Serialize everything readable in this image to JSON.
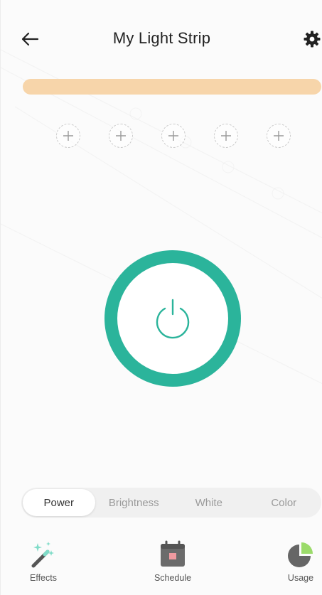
{
  "header": {
    "title": "My Light Strip",
    "back_icon": "arrow-left-icon",
    "settings_icon": "gear-icon"
  },
  "color_bar": {
    "color": "#f7d5aa"
  },
  "presets": [
    {
      "icon": "plus-icon"
    },
    {
      "icon": "plus-icon"
    },
    {
      "icon": "plus-icon"
    },
    {
      "icon": "plus-icon"
    },
    {
      "icon": "plus-icon"
    }
  ],
  "power_button": {
    "icon": "power-icon",
    "ring_color": "#2bb49b"
  },
  "mode_tabs": [
    {
      "label": "Power",
      "active": true
    },
    {
      "label": "Brightness",
      "active": false
    },
    {
      "label": "White",
      "active": false
    },
    {
      "label": "Color",
      "active": false
    }
  ],
  "toolbar": {
    "effects_label": "Effects",
    "schedule_label": "Schedule",
    "usage_label": "Usage",
    "effects_icon": "magic-wand-icon",
    "schedule_icon": "calendar-icon",
    "usage_icon": "pie-chart-icon"
  },
  "colors": {
    "accent": "#2bb49b",
    "accent_light": "#7fdcc8"
  }
}
